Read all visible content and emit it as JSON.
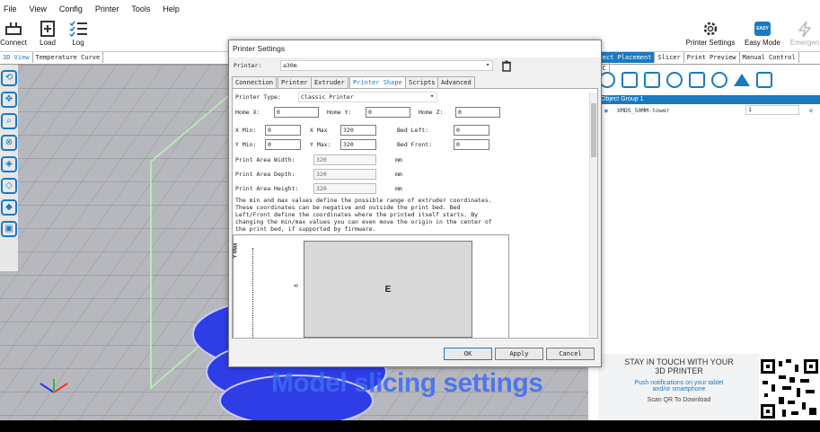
{
  "menu": [
    "File",
    "View",
    "Config",
    "Printer",
    "Tools",
    "Help"
  ],
  "toolbar": {
    "connect": "Connect",
    "load": "Load",
    "log": "Log",
    "printer_settings": "Printer Settings",
    "easy_mode": "Easy Mode",
    "easy_badge": "EASY",
    "emergency": "Emergen"
  },
  "left_tabs": [
    "3D View",
    "Temperature Curve"
  ],
  "right_tabs": [
    "Object Placement",
    "Slicer",
    "Print Preview",
    "Manual Control",
    "SD C"
  ],
  "object_group": "Object Group 1",
  "object_row": {
    "name": "XMDS_50MM-tower",
    "count": "1"
  },
  "promo": {
    "line1": "STAY IN TOUCH WITH YOUR",
    "line2": "3D PRINTER",
    "line3": "Push notifications on your tablet",
    "line4": "and/or smartphone",
    "line5": "Scan QR To Download"
  },
  "dialog": {
    "title": "Printer Settings",
    "printer_label": "Printer:",
    "printer_value": "a30m",
    "tabs": [
      "Connection",
      "Printer",
      "Extruder",
      "Printer Shape",
      "Scripts",
      "Advanced"
    ],
    "active_tab": "Printer Shape",
    "printer_type_label": "Printer Type:",
    "printer_type_value": "Classic Printer",
    "home_x_label": "Home X:",
    "home_x": "0",
    "home_y_label": "Home Y:",
    "home_y": "0",
    "home_z_label": "Home Z:",
    "home_z": "0",
    "x_min_label": "X Min:",
    "x_min": "0",
    "x_max_label": "X Max",
    "x_max": "320",
    "bed_left_label": "Bed Left:",
    "bed_left": "0",
    "y_min_label": "Y Min:",
    "y_min": "0",
    "y_max_label": "Y Max:",
    "y_max": "320",
    "bed_front_label": "Bed Front:",
    "bed_front": "0",
    "width_label": "Print Area Width:",
    "width": "320",
    "depth_label": "Print Area Depth:",
    "depth": "320",
    "height_label": "Print Area Height:",
    "height": "320",
    "unit": "mm",
    "help": [
      "The min and max values define the possible range of extruder coordinates.",
      "These coordinates can be negative and outside the print bed. Bed",
      "Left/Front define the coordinates where the printed itself starts. By",
      "changing the min/max values you can even move the origin in the center of",
      "the print bed, if supported by firmware."
    ],
    "diagram_axis": "Y Max",
    "diagram_label": "E",
    "diagram_tick": "B",
    "ok": "OK",
    "apply": "Apply",
    "cancel": "Cancel"
  },
  "caption": "Model slicing settings"
}
